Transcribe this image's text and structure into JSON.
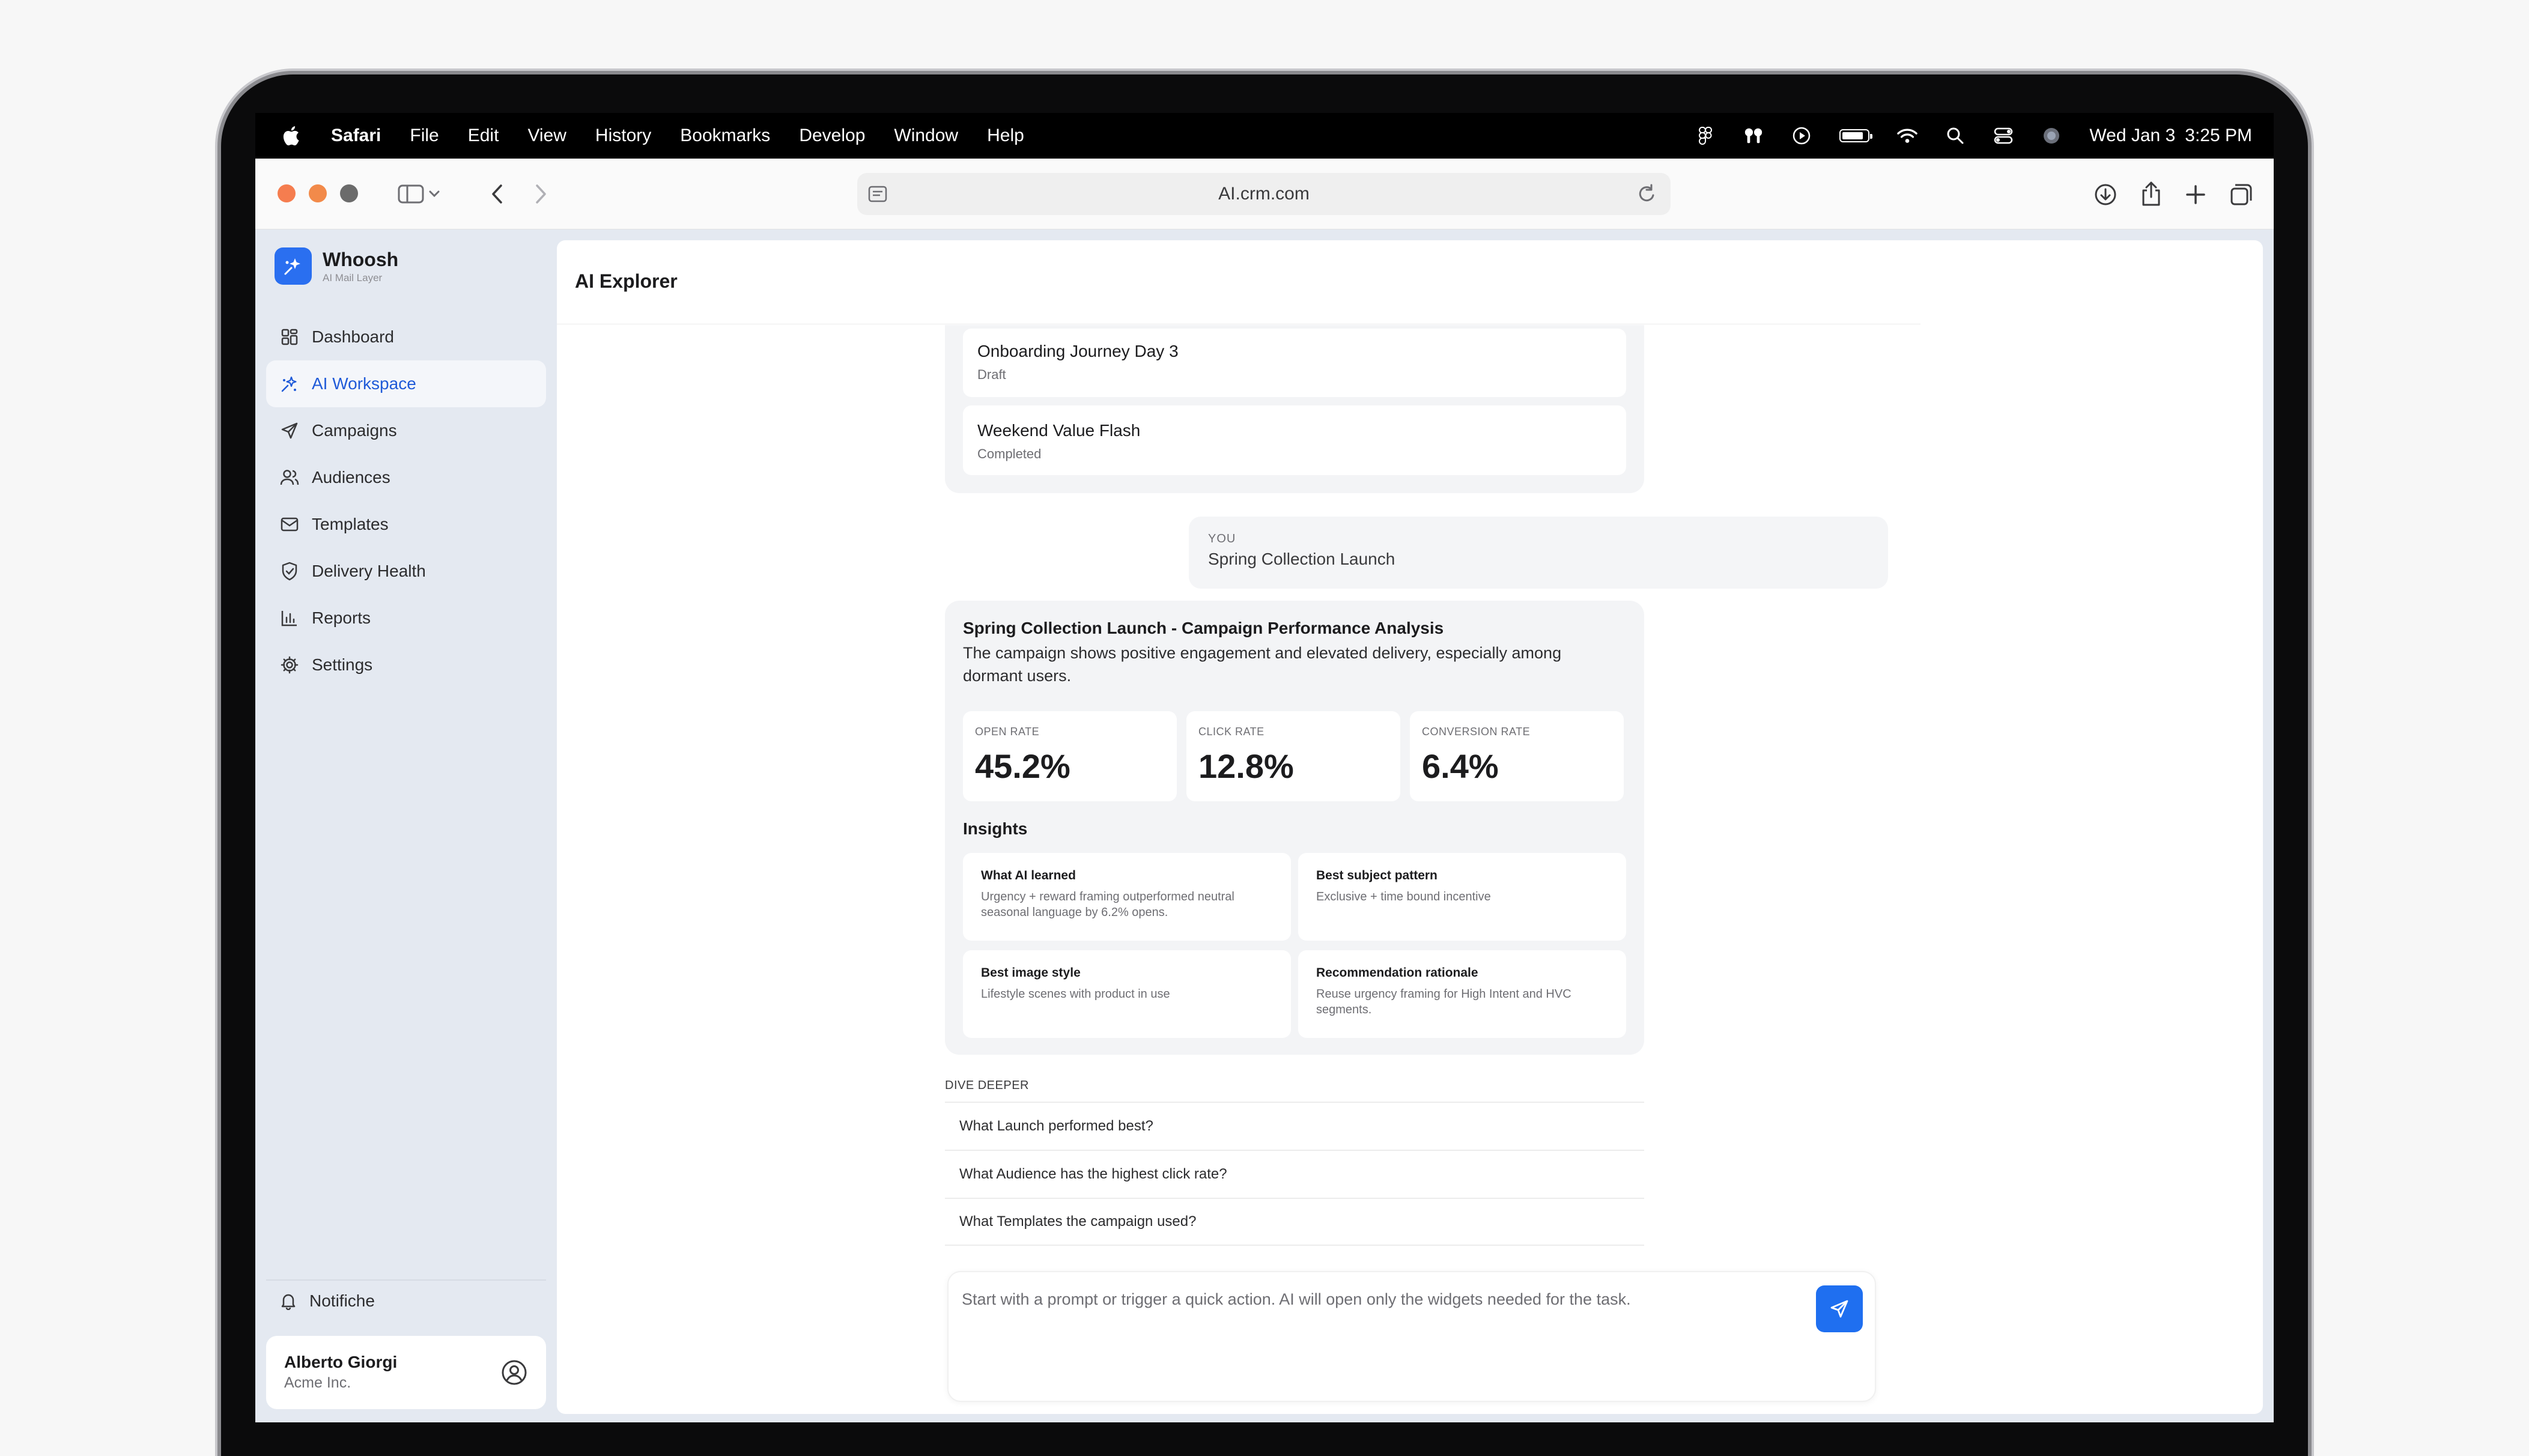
{
  "menubar": {
    "app": "Safari",
    "items": [
      "File",
      "Edit",
      "View",
      "History",
      "Bookmarks",
      "Develop",
      "Window",
      "Help"
    ],
    "date": "Wed Jan 3",
    "time": "3:25 PM"
  },
  "browser": {
    "url": "AI.crm.com"
  },
  "sidebar": {
    "brand_name": "Whoosh",
    "brand_sub": "AI Mail Layer",
    "items": [
      {
        "label": "Dashboard",
        "icon": "grid-icon"
      },
      {
        "label": "AI Workspace",
        "icon": "sparkles-icon"
      },
      {
        "label": "Campaigns",
        "icon": "send-icon"
      },
      {
        "label": "Audiences",
        "icon": "users-icon"
      },
      {
        "label": "Templates",
        "icon": "mail-icon"
      },
      {
        "label": "Delivery Health",
        "icon": "shield-icon"
      },
      {
        "label": "Reports",
        "icon": "bar-chart-icon"
      },
      {
        "label": "Settings",
        "icon": "gear-icon"
      }
    ],
    "notifications_label": "Notifiche",
    "user_name": "Alberto Giorgi",
    "user_org": "Acme Inc."
  },
  "main": {
    "title": "AI Explorer",
    "campaign_list": [
      {
        "name": "Onboarding Journey Day 3",
        "status": "Draft"
      },
      {
        "name": "Weekend Value Flash",
        "status": "Completed"
      }
    ],
    "you_label": "YOU",
    "you_message": "Spring Collection Launch",
    "analysis": {
      "title": "Spring Collection Launch - Campaign Performance Analysis",
      "description": "The campaign shows positive engagement and elevated delivery, especially among dormant users.",
      "metrics": [
        {
          "label": "OPEN RATE",
          "value": "45.2%"
        },
        {
          "label": "CLICK RATE",
          "value": "12.8%"
        },
        {
          "label": "CONVERSION RATE",
          "value": "6.4%"
        }
      ],
      "insights_title": "Insights",
      "insights": [
        {
          "title": "What AI learned",
          "text": "Urgency + reward framing outperformed neutral seasonal language by 6.2% opens."
        },
        {
          "title": "Best subject pattern",
          "text": "Exclusive + time bound incentive"
        },
        {
          "title": "Best image style",
          "text": "Lifestyle scenes with product in use"
        },
        {
          "title": "Recommendation rationale",
          "text": "Reuse urgency framing for High Intent and HVC segments."
        }
      ]
    },
    "dive_deeper_label": "DIVE DEEPER",
    "dive_deeper": [
      "What Launch performed best?",
      "What Audience has the highest click rate?",
      "What Templates the campaign used?"
    ],
    "composer_placeholder": "Start with a prompt or trigger a quick action. AI will open only the widgets needed for the task."
  },
  "colors": {
    "accent": "#1f6ff0",
    "active_nav_text": "#1f5ad8",
    "sidebar_bg": "#e4e9f1",
    "traffic_red": "#f57d4f",
    "traffic_yellow": "#f28a4a",
    "traffic_green": "#6b6b6b"
  }
}
